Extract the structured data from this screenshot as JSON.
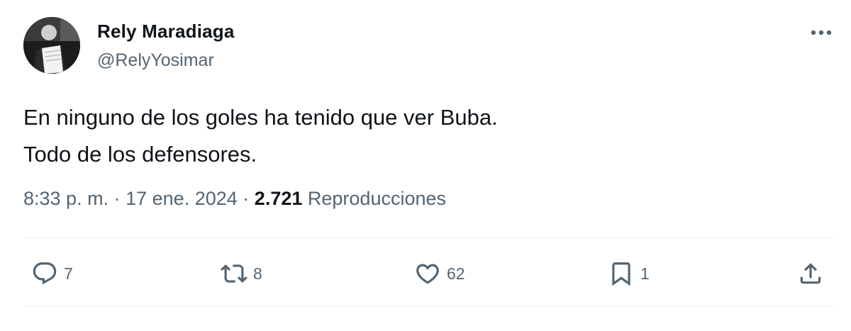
{
  "author": {
    "display_name": "Rely Maradiaga",
    "handle": "@RelyYosimar"
  },
  "tweet": {
    "lines": [
      "En ninguno de los goles ha tenido que ver Buba.",
      "Todo de los defensores."
    ]
  },
  "meta": {
    "time": "8:33 p. m.",
    "separator": "·",
    "date": "17 ene. 2024",
    "views_count": "2.721",
    "views_label": "Reproducciones"
  },
  "actions": {
    "reply_count": "7",
    "retweet_count": "8",
    "like_count": "62",
    "bookmark_count": "1"
  },
  "icons": {
    "more": "more-dots-icon",
    "reply": "reply-icon",
    "retweet": "retweet-icon",
    "like": "heart-icon",
    "bookmark": "bookmark-icon",
    "share": "share-icon"
  },
  "colors": {
    "text_primary": "#0f1419",
    "text_secondary": "#536471",
    "divider": "#eff3f4"
  }
}
